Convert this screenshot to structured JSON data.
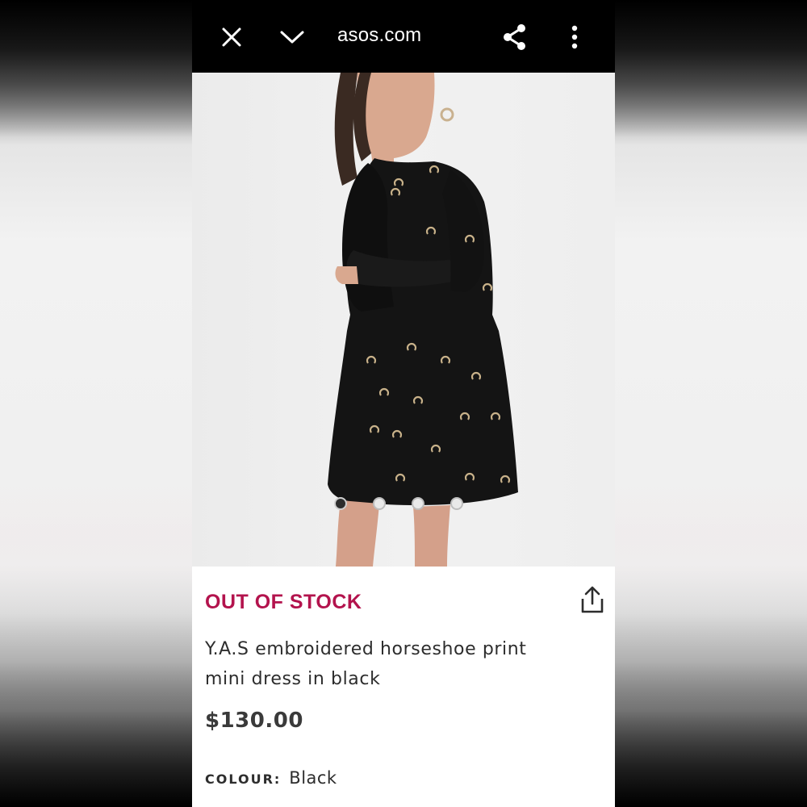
{
  "browser": {
    "url": "asos.com",
    "close_icon": "close-icon",
    "collapse_icon": "chevron-down-icon",
    "share_icon": "share-icon",
    "menu_icon": "more-vertical-icon"
  },
  "product": {
    "image_count": 4,
    "active_image": 1,
    "stock_status": "OUT OF STOCK",
    "title": "Y.A.S embroidered horseshoe print mini dress in black",
    "price": "$130.00",
    "colour_label": "COLOUR:",
    "colour_value": "Black",
    "share_icon": "upload-share-icon"
  },
  "colors": {
    "stock_accent": "#b3134d",
    "topbar_bg": "#000000"
  }
}
